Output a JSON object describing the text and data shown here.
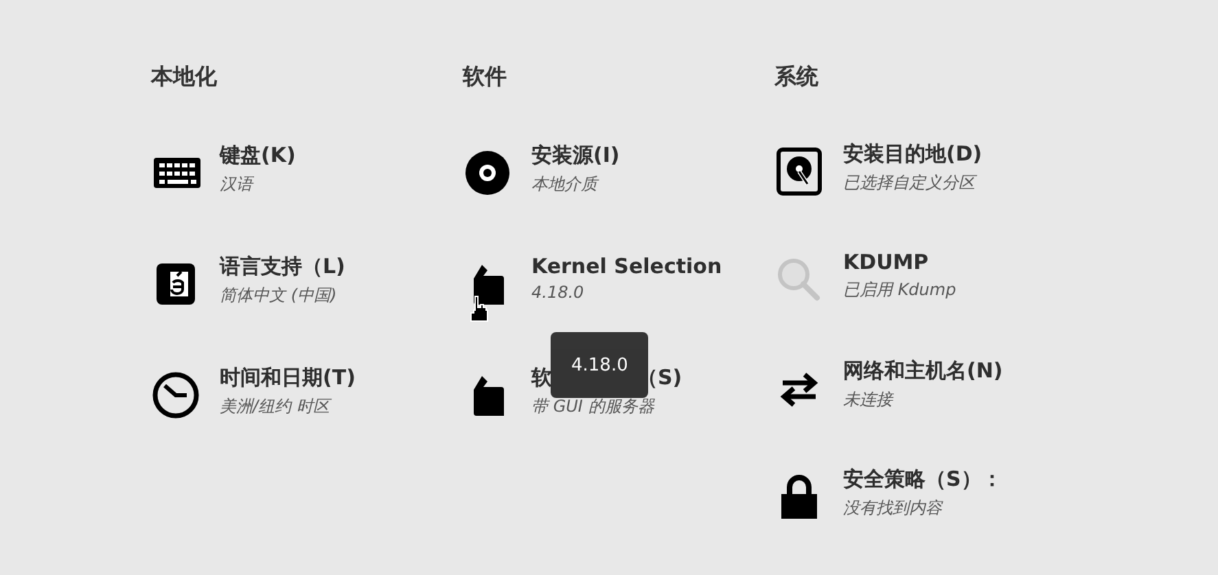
{
  "sections": [
    {
      "heading": "本地化",
      "items": [
        {
          "title": "键盘(K)",
          "status": "汉语"
        },
        {
          "title": "语言支持（L)",
          "status": "简体中文 (中国)"
        },
        {
          "title": "时间和日期(T)",
          "status": "美洲/纽约 时区"
        }
      ]
    },
    {
      "heading": "软件",
      "items": [
        {
          "title": "安装源(I)",
          "status": "本地介质"
        },
        {
          "title": "Kernel Selection",
          "status": "4.18.0"
        },
        {
          "title_parts": [
            "软",
            "（S)"
          ],
          "status": "带 GUI 的服务器",
          "tooltip": "4.18.0"
        }
      ]
    },
    {
      "heading": "系统",
      "items": [
        {
          "title": "安装目的地(D)",
          "status": "已选择自定义分区"
        },
        {
          "title": "KDUMP",
          "status": "已启用 Kdump"
        },
        {
          "title": "网络和主机名(N)",
          "status": "未连接"
        },
        {
          "title": "安全策略（S）：",
          "status": "没有找到内容"
        }
      ]
    }
  ]
}
